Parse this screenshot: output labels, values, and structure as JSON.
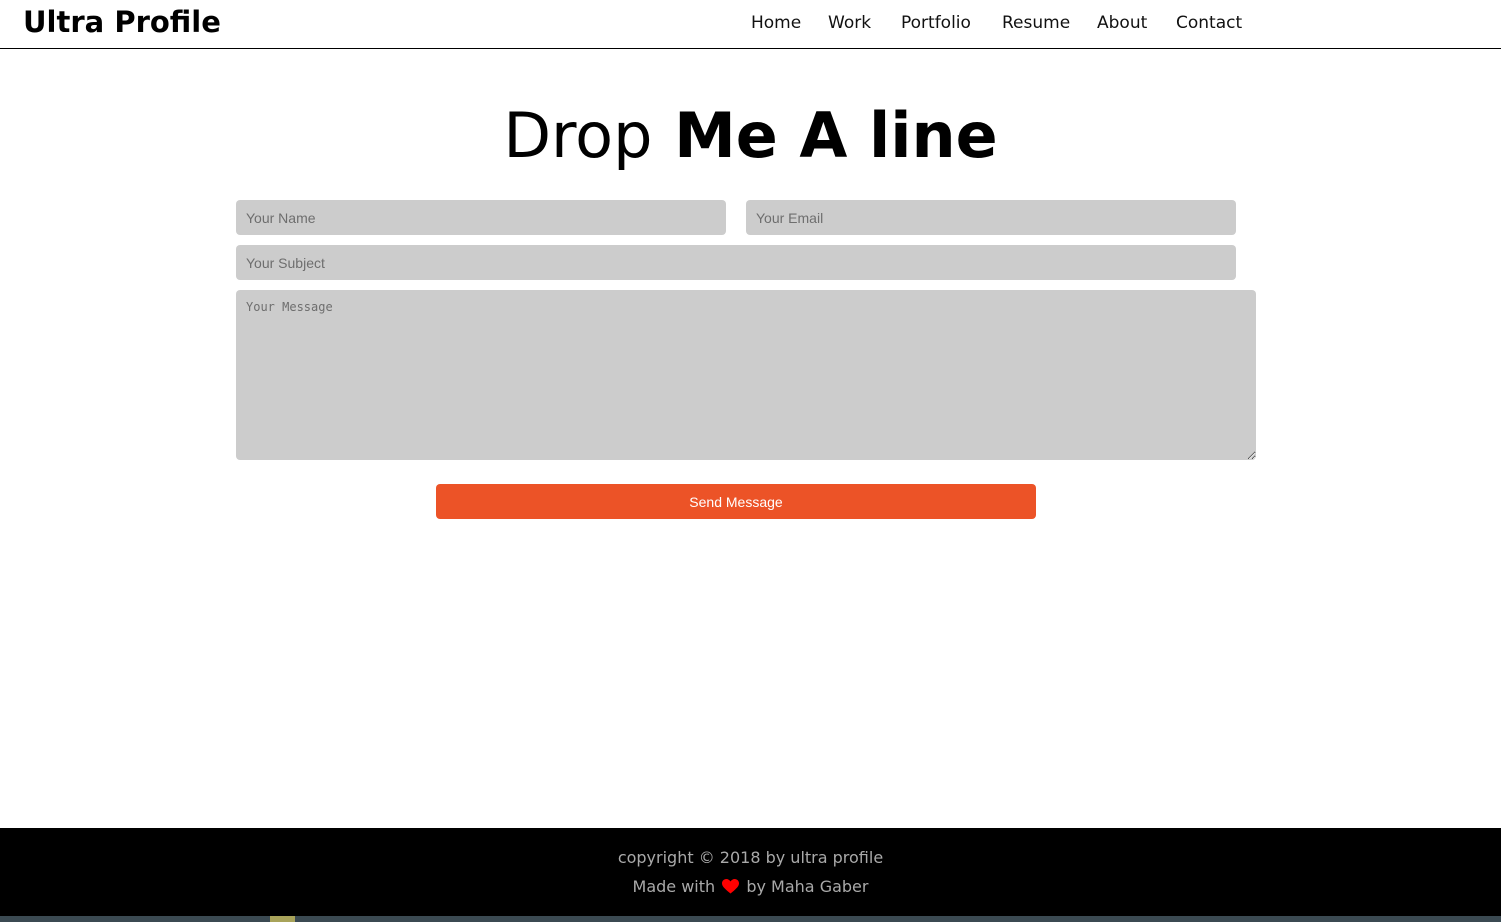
{
  "brand": {
    "name": "Ultra Profile"
  },
  "nav": {
    "items": [
      {
        "label": "Home"
      },
      {
        "label": "Work"
      },
      {
        "label": "Portfolio"
      },
      {
        "label": "Resume"
      },
      {
        "label": "About"
      },
      {
        "label": "Contact"
      }
    ]
  },
  "contact": {
    "heading_light": "Drop",
    "heading_bold": "Me A line",
    "name_placeholder": "Your Name",
    "email_placeholder": "Your Email",
    "subject_placeholder": "Your Subject",
    "message_placeholder": "Your Message",
    "send_label": "Send Message"
  },
  "footer": {
    "copyright": "copyright © 2018 by ultra profile",
    "made_with": "Made with",
    "by_author": "by Maha Gaber"
  },
  "colors": {
    "accent": "#ec5327",
    "field_bg": "#cccccc",
    "footer_bg": "#000000",
    "footer_text": "#a9a9a9",
    "heart": "#ff0000"
  },
  "icons": {
    "heart": "heart-icon"
  }
}
